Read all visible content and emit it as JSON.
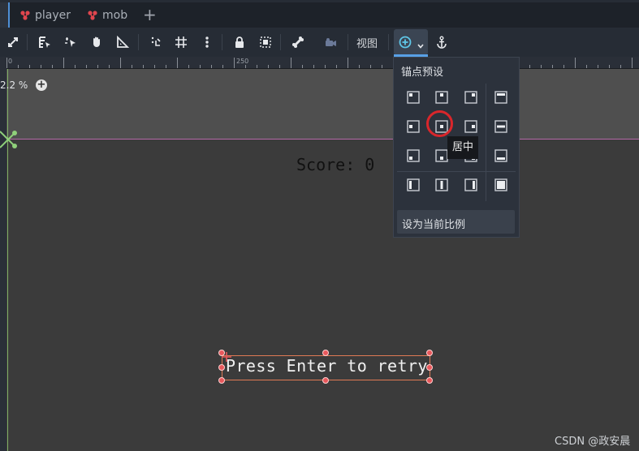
{
  "tabs": [
    {
      "label": "player"
    },
    {
      "label": "mob"
    }
  ],
  "add_tab_symbol": "+",
  "toolbar": {
    "view_label": "视图",
    "icons": [
      "expand-icon",
      "select-list-icon",
      "select-cursor-icon",
      "pan-hand-icon",
      "ruler-icon",
      "snap-icon",
      "grid-icon",
      "more-vertical-icon",
      "lock-icon",
      "group-icon",
      "bone-icon",
      "camera-icon",
      "anchor-layout-icon",
      "chevron-down-icon",
      "anchor-icon"
    ]
  },
  "viewport": {
    "ruler_label": "250",
    "ruler_start": "0",
    "zoom": "2.2 %",
    "zoom_plus": "+",
    "score_text": "Score: 0",
    "retry_text": "Press Enter to retry"
  },
  "anchors_popup": {
    "title": "锚点预设",
    "footer_button": "设为当前比例",
    "tooltip": "居中",
    "presets": [
      {
        "name": "top-left"
      },
      {
        "name": "center-top"
      },
      {
        "name": "top-right"
      },
      {
        "name": "top-wide"
      },
      {
        "name": "center-left"
      },
      {
        "name": "center"
      },
      {
        "name": "center-right"
      },
      {
        "name": "h-center-wide"
      },
      {
        "name": "bottom-left"
      },
      {
        "name": "center-bottom"
      },
      {
        "name": "bottom-right"
      },
      {
        "name": "bottom-wide"
      },
      {
        "name": "left-wide"
      },
      {
        "name": "v-center-wide"
      },
      {
        "name": "right-wide"
      },
      {
        "name": "full-rect"
      }
    ]
  },
  "watermark": "CSDN @政安晨",
  "colors": {
    "accent": "#58a0e6",
    "highlight_ring": "#d9262b",
    "selection_box": "#e07a55",
    "scene_icon": "#e0464e"
  }
}
